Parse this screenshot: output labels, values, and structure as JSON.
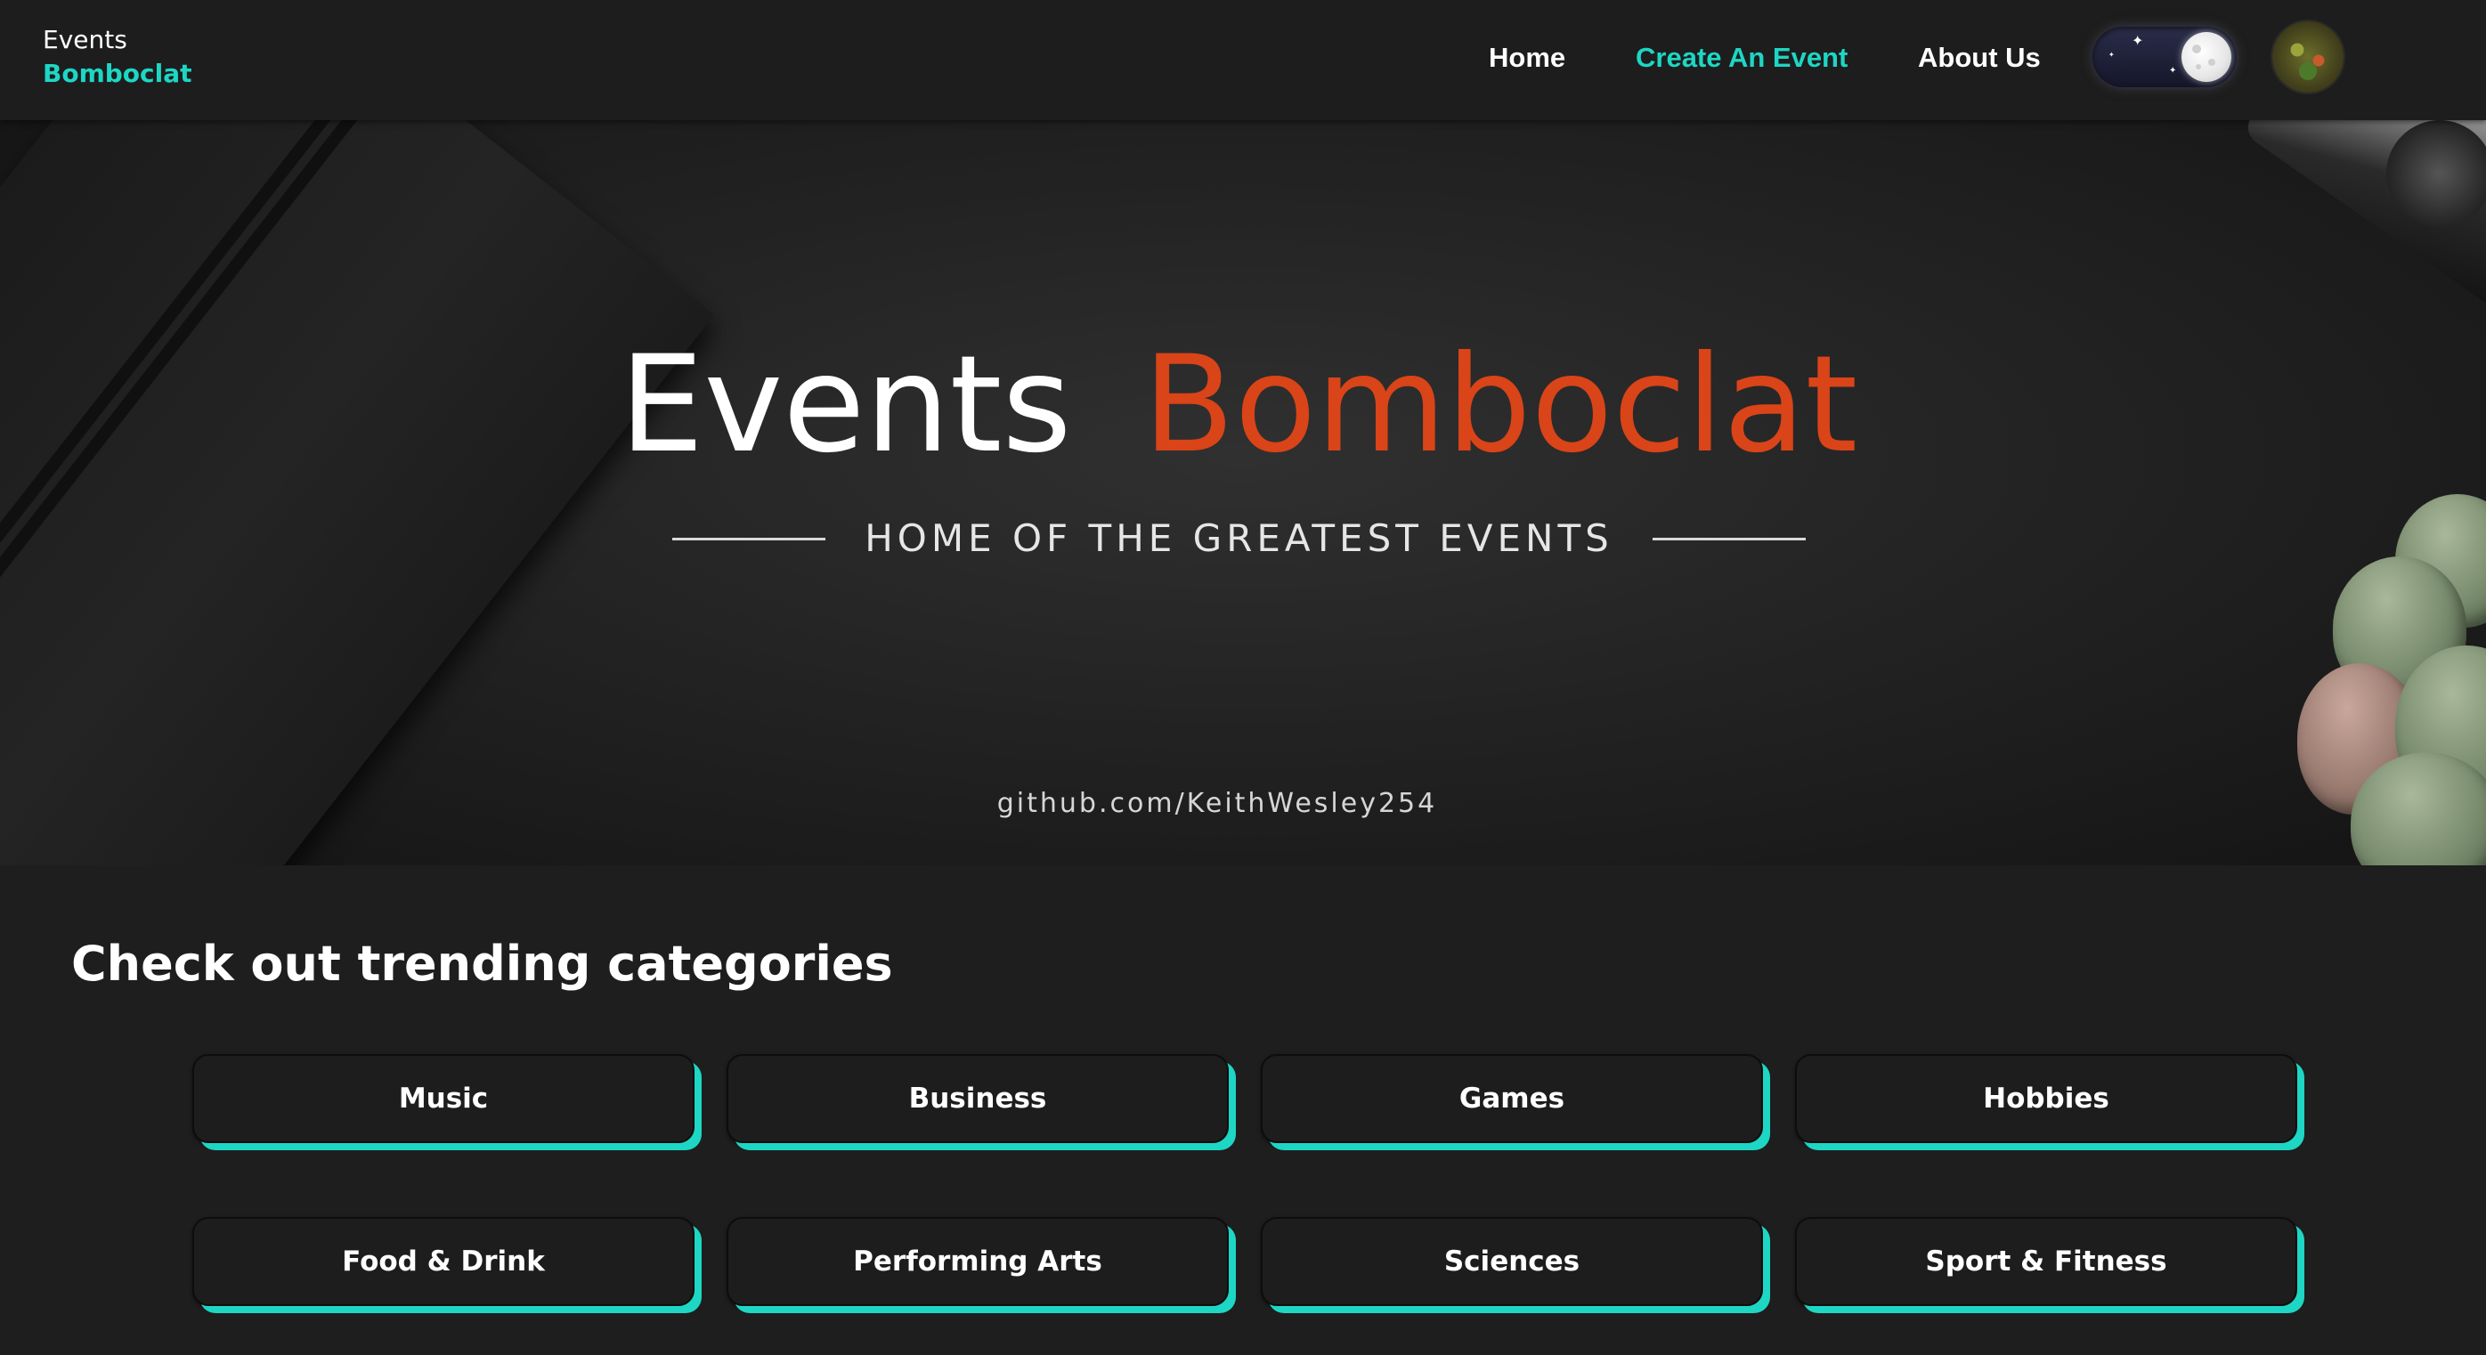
{
  "navbar": {
    "brand_line1": "Events",
    "brand_line2": "Bomboclat",
    "links": [
      {
        "label": "Home",
        "active": false
      },
      {
        "label": "Create An Event",
        "active": true
      },
      {
        "label": "About Us",
        "active": false
      }
    ],
    "theme_toggle": {
      "state": "dark",
      "icon": "moon-icon"
    },
    "avatar_icon": "user-avatar"
  },
  "hero": {
    "title_word1": "Events",
    "title_word2": "Bomboclat",
    "tagline": "HOME OF THE GREATEST EVENTS",
    "github": "github.com/KeithWesley254"
  },
  "categories": {
    "title": "Check out trending categories",
    "items": [
      "Music",
      "Business",
      "Games",
      "Hobbies",
      "Food & Drink",
      "Performing Arts",
      "Sciences",
      "Sport & Fitness"
    ]
  },
  "colors": {
    "accent": "#1ed6c4",
    "hero_title_accent": "#d94418",
    "background": "#1e1e1e",
    "navbar": "#1d1d1d"
  }
}
